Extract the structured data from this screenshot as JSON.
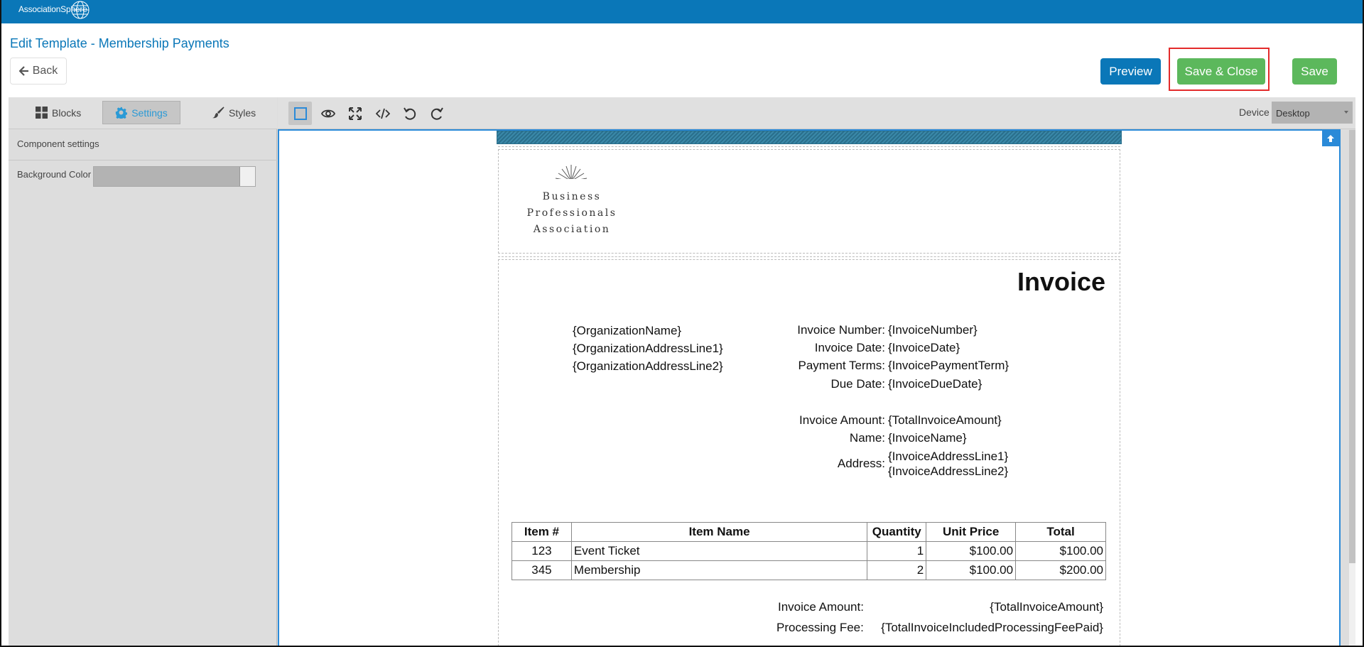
{
  "brand": {
    "logo_text": "AssociationSphere"
  },
  "header": {
    "title": "Edit Template - Membership Payments",
    "back_label": "Back",
    "preview_label": "Preview",
    "save_close_label": "Save & Close",
    "save_label": "Save"
  },
  "panel": {
    "tabs": [
      {
        "label": "Blocks",
        "icon": "grid-icon"
      },
      {
        "label": "Settings",
        "icon": "gear-icon"
      },
      {
        "label": "Styles",
        "icon": "paintbrush-icon"
      }
    ],
    "component_settings": "Component settings",
    "background_color_label": "Background Color"
  },
  "toolbar": {
    "tools": [
      "select-frame-icon",
      "eye-icon",
      "fullscreen-icon",
      "code-icon",
      "undo-icon",
      "redo-icon"
    ],
    "device_label": "Device",
    "device_value": "Desktop"
  },
  "template": {
    "logo_lines": [
      "Business",
      "Professionals",
      "Association"
    ],
    "invoice_title": "Invoice",
    "org": [
      "{OrganizationName}",
      "{OrganizationAddressLine1}",
      "{OrganizationAddressLine2}"
    ],
    "details": [
      {
        "label": "Invoice Number:",
        "value": "{InvoiceNumber}"
      },
      {
        "label": "Invoice Date:",
        "value": "{InvoiceDate}"
      },
      {
        "label": "Payment Terms:",
        "value": "{InvoicePaymentTerm}"
      },
      {
        "label": "Due Date:",
        "value": "{InvoiceDueDate}"
      }
    ],
    "invoice_amount_label": "Invoice Amount:",
    "invoice_amount_value": "{TotalInvoiceAmount}",
    "name_label": "Name:",
    "name_value": "{InvoiceName}",
    "address_label": "Address:",
    "address_line1": "{InvoiceAddressLine1}",
    "address_line2": "{InvoiceAddressLine2}",
    "table": {
      "headers": [
        "Item #",
        "Item Name",
        "Quantity",
        "Unit Price",
        "Total"
      ],
      "rows": [
        [
          "123",
          "Event Ticket",
          "1",
          "$100.00",
          "$100.00"
        ],
        [
          "345",
          "Membership",
          "2",
          "$100.00",
          "$200.00"
        ]
      ]
    },
    "summary": [
      {
        "label": "Invoice Amount:",
        "value": "{TotalInvoiceAmount}"
      },
      {
        "label": "Processing Fee:",
        "value": "{TotalInvoiceIncludedProcessingFeePaid}"
      }
    ]
  },
  "colors": {
    "brand_blue": "#0a77b8",
    "save_green": "#5cb85c",
    "highlight_red": "#e32b2b",
    "selection_blue": "#2a8ad8"
  }
}
